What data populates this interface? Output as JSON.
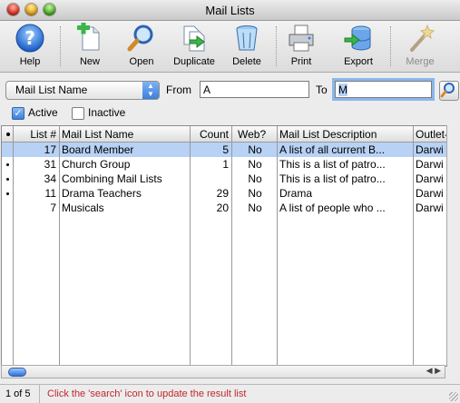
{
  "window": {
    "title": "Mail Lists"
  },
  "toolbar": {
    "buttons": [
      {
        "label": "Help",
        "icon": "help-icon"
      },
      {
        "label": "New",
        "icon": "new-document-icon"
      },
      {
        "label": "Open",
        "icon": "magnifier-icon"
      },
      {
        "label": "Duplicate",
        "icon": "duplicate-icon"
      },
      {
        "label": "Delete",
        "icon": "trash-icon"
      },
      {
        "label": "Print",
        "icon": "printer-icon"
      },
      {
        "label": "Export",
        "icon": "export-database-icon"
      },
      {
        "label": "Merge",
        "icon": "magic-wand-icon",
        "disabled": true
      }
    ]
  },
  "filter": {
    "field_selected": "Mail List Name",
    "from_label": "From",
    "from_value": "A",
    "to_label": "To",
    "to_value": "M"
  },
  "checkboxes": {
    "active": {
      "label": "Active",
      "checked": true
    },
    "inactive": {
      "label": "Inactive",
      "checked": false
    }
  },
  "table": {
    "headers": [
      "List #",
      "Mail List Name",
      "Count",
      "Web?",
      "Mail List Description",
      "Outlet-C"
    ],
    "rows": [
      {
        "flag": false,
        "id": "17",
        "name": "Board Member",
        "count": "5",
        "web": "No",
        "desc": "A list of all current B...",
        "outlet": "Darwi",
        "selected": true
      },
      {
        "flag": true,
        "id": "31",
        "name": "Church Group",
        "count": "1",
        "web": "No",
        "desc": "This is a list of patro...",
        "outlet": "Darwi",
        "selected": false
      },
      {
        "flag": true,
        "id": "34",
        "name": "Combining Mail Lists",
        "count": "",
        "web": "No",
        "desc": "This is a list of patro...",
        "outlet": "Darwi",
        "selected": false
      },
      {
        "flag": true,
        "id": "11",
        "name": "Drama Teachers",
        "count": "29",
        "web": "No",
        "desc": "Drama",
        "outlet": "Darwi",
        "selected": false
      },
      {
        "flag": false,
        "id": "7",
        "name": "Musicals",
        "count": "20",
        "web": "No",
        "desc": "A list of people who ...",
        "outlet": "Darwi",
        "selected": false
      }
    ]
  },
  "status": {
    "count": "1 of 5",
    "message": "Click the 'search' icon to update the result list"
  },
  "colors": {
    "selection": "#b7d2f5",
    "status_message": "#c1272d",
    "focus": "#8bb6ec"
  }
}
